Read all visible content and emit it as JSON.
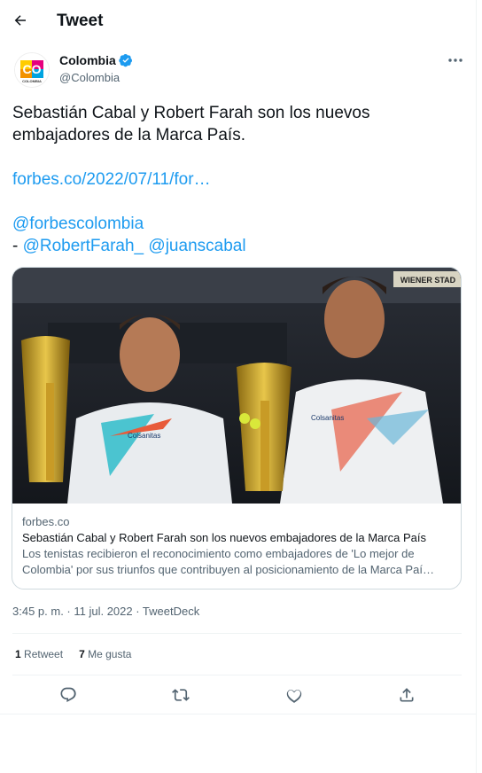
{
  "header": {
    "title": "Tweet"
  },
  "author": {
    "name": "Colombia",
    "handle": "@Colombia",
    "avatar_text": "CO",
    "avatar_subtext": "COLOMBIA"
  },
  "tweet": {
    "text_line1": "Sebastián Cabal y Robert Farah son los nuevos embajadores de la Marca País.",
    "link": "forbes.co/2022/07/11/for…",
    "mention1": "@forbescolombia",
    "dash": "-",
    "mention2": "@RobertFarah_",
    "mention3": "@juanscabal"
  },
  "card": {
    "domain": "forbes.co",
    "title": "Sebastián Cabal y Robert Farah son los nuevos embajadores de la Marca País",
    "description": "Los tenistas recibieron el reconocimiento como embajadores de 'Lo mejor de Colombia' por sus triunfos que contribuyen al posicionamiento de la Marca Paí…",
    "image_sign": "WIENER STAD",
    "shirt_text": "Colsanitas"
  },
  "meta": {
    "timestamp": "3:45 p. m. · 11 jul. 2022 · TweetDeck"
  },
  "stats": {
    "retweets_count": "1",
    "retweets_label": "Retweet",
    "likes_count": "7",
    "likes_label": "Me gusta"
  },
  "colors": {
    "link": "#1d9bf0",
    "verified": "#1d9bf0",
    "secondary_text": "#536471",
    "border": "#cfd9de"
  },
  "icons": [
    "back-arrow-icon",
    "verified-badge-icon",
    "more-icon",
    "reply-icon",
    "retweet-icon",
    "like-icon",
    "share-icon"
  ]
}
